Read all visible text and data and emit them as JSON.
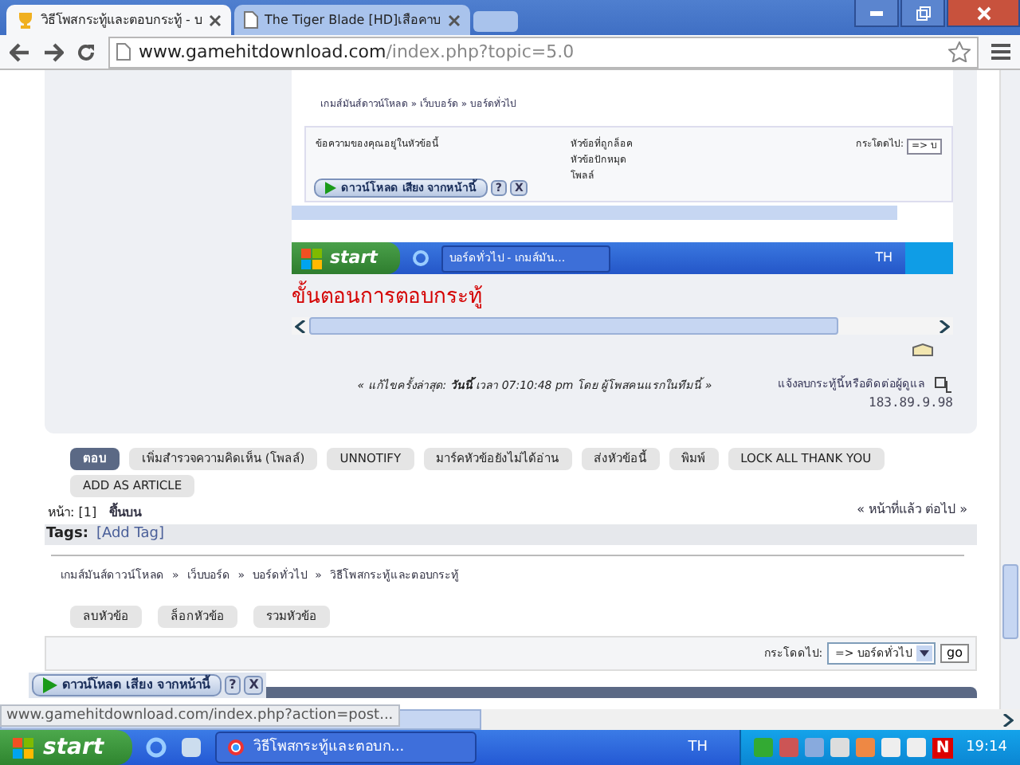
{
  "browser": {
    "tabs": [
      {
        "title": "วิธีโพสกระทู้และตอบกระทู้ - บ",
        "selected": true
      },
      {
        "title": "The Tiger Blade [HD]เสือคาบ",
        "selected": false
      }
    ],
    "url_host": "www.gamehitdownload.com",
    "url_path": "/index.php?topic=5.0"
  },
  "post": {
    "screenshot": {
      "breadcrumb": "เกมส์มันส์ดาวน์โหลด » เว็บบอร์ด » บอร์ดทั่วไป",
      "legend": [
        "ข้อความของคุณอยู่ในหัวข้อนี้",
        "หัวข้อที่ถูกล็อค",
        "หัวข้อปักหมุด",
        "โพลล์"
      ],
      "jump_label": "กระโดดไป:",
      "jump_value": "=> บ",
      "download_bar": "ดาวน์โหลด เสียง จากหน้านี้",
      "help": "?",
      "close": "X",
      "start": "start",
      "task": "บอร์ดทั่วไป - เกมส์มัน...",
      "lang": "TH"
    },
    "heading": "ขั้นตอนการตอบกระทู้",
    "edit_note": "« แก้ไขครั้งล่าสุด: **วันนี้** เวลา 07:10:48 pm โดย ผู้โพสคนแรกในทีมนี้ »",
    "report": "แจ้งลบกระทู้นี้หรือติดต่อผู้ดูแล",
    "ip": "183.89.9.98"
  },
  "buttons": [
    {
      "label": "ตอบ",
      "selected": true
    },
    {
      "label": "เพิ่มสำรวจความคิดเห็น (โพลล์)",
      "selected": false
    },
    {
      "label": "UNNOTIFY",
      "selected": false
    },
    {
      "label": "มาร์คหัวข้อยังไม่ได้อ่าน",
      "selected": false
    },
    {
      "label": "ส่งหัวข้อนี้",
      "selected": false
    },
    {
      "label": "พิมพ์",
      "selected": false
    },
    {
      "label": "LOCK ALL THANK YOU",
      "selected": false
    },
    {
      "label": "ADD AS ARTICLE",
      "selected": false
    }
  ],
  "pages": {
    "label": "หน้า: [1]",
    "top": "ขึ้นบน",
    "nav": "« หน้าที่แล้ว ต่อไป »"
  },
  "tags": {
    "label": "Tags:",
    "add": "[Add Tag]"
  },
  "breadcrumb": [
    "เกมส์มันส์ดาวน์โหลด",
    "เว็บบอร์ด",
    "บอร์ดทั่วไป",
    "วิธีโพสกระทู้และตอบกระทู้"
  ],
  "breadcrumb_sep": "»",
  "mod_buttons": [
    "ลบหัวข้อ",
    "ล็อกหัวข้อ",
    "รวมหัวข้อ"
  ],
  "jump": {
    "label": "กระโดดไป:",
    "value": "=> บอร์ดทั่วไป",
    "go": "go"
  },
  "download_bar": {
    "label": "ดาวน์โหลด เสียง จากหน้านี้",
    "help": "?",
    "close": "X"
  },
  "status": "www.gamehitdownload.com/index.php?action=post...",
  "taskbar": {
    "start": "start",
    "task": "วิธีโพสกระทู้และตอบก...",
    "lang": "TH",
    "tray_letter": "N",
    "clock": "19:14"
  }
}
